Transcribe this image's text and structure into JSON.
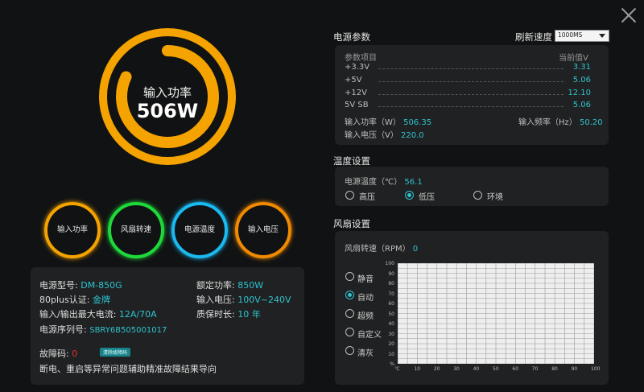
{
  "gauge": {
    "title": "输入功率",
    "value": "506W",
    "level": 0.82
  },
  "rings": [
    {
      "label": "输入功率",
      "color": "#f5a300"
    },
    {
      "label": "风扇转速",
      "color": "#1ed93a"
    },
    {
      "label": "电源温度",
      "color": "#1ab9f0"
    },
    {
      "label": "输入电压",
      "color": "#f08a00"
    }
  ],
  "info": {
    "model_label": "电源型号:",
    "model": "DM-850G",
    "rated_label": "额定功率:",
    "rated": "850W",
    "cert_label": "80plus认证:",
    "cert": "金牌",
    "voltage_label": "输入电压:",
    "voltage": "100V~240V",
    "current_label": "输入/输出最大电流:",
    "current": "12A/70A",
    "warranty_label": "质保时长:",
    "warranty": "10 年",
    "serial_label": "电源序列号:",
    "serial": "SBRY6B505001017",
    "fault_label": "故障码:",
    "fault": "0",
    "clear_button": "清除故障码",
    "fault_desc": "断电、重启等异常问题辅助精准故障结果导向"
  },
  "params": {
    "title": "电源参数",
    "refresh_label": "刷新速度",
    "refresh_value": "1000MS",
    "col_item": "参数项目",
    "col_value": "当前值V",
    "rows": [
      {
        "name": "+3.3V",
        "value": "3.31"
      },
      {
        "name": "+5V",
        "value": "5.06"
      },
      {
        "name": "+12V",
        "value": "12.10"
      },
      {
        "name": "5V SB",
        "value": "5.06"
      }
    ],
    "in_power_label": "输入功率（W）",
    "in_power": "506.35",
    "in_freq_label": "输入频率（Hz）",
    "in_freq": "50.20",
    "in_volt_label": "输入电压（V）",
    "in_volt": "220.0"
  },
  "temp": {
    "title": "温度设置",
    "label": "电源温度（℃）",
    "value": "56.1",
    "options": [
      "高压",
      "低压",
      "环境"
    ],
    "selected": "低压"
  },
  "fan": {
    "title": "风扇设置",
    "speed_label": "风扇转速（RPM）",
    "speed": "0",
    "modes": [
      "静音",
      "自动",
      "超频",
      "自定义",
      "清灰"
    ],
    "selected": "自动"
  },
  "chart_data": {
    "type": "line",
    "x_ticks": [
      "℃",
      "10",
      "20",
      "30",
      "40",
      "50",
      "60",
      "70",
      "80",
      "90",
      "100"
    ],
    "y_ticks": [
      "100",
      "90",
      "80",
      "70",
      "60",
      "50",
      "40",
      "30",
      "20",
      "10",
      "%"
    ],
    "xlim": [
      0,
      100
    ],
    "ylim": [
      0,
      100
    ],
    "grid": true,
    "series": []
  }
}
